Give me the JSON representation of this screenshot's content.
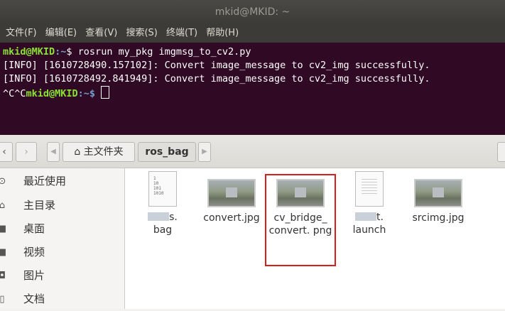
{
  "terminal": {
    "title": "mkid@MKID: ~",
    "menu": [
      "文件(F)",
      "编辑(E)",
      "查看(V)",
      "搜索(S)",
      "终端(T)",
      "帮助(H)"
    ],
    "prompt_user": "mkid@MKID",
    "prompt_path": ":~",
    "command": "$ rosrun my_pkg imgmsg_to_cv2.py",
    "lines": [
      "[INFO] [1610728490.157102]: Convert image_message to cv2_img successfully.",
      "[INFO] [1610728492.841949]: Convert image_message to cv2_img successfully."
    ],
    "last_prefix": "^C^C",
    "last_prompt_path": ":~$"
  },
  "toolbar": {
    "back_icon": "‹",
    "forward_icon": "›",
    "home_label": "主文件夹",
    "current_label": "ros_bag"
  },
  "sidebar": {
    "items": [
      {
        "label": "最近使用",
        "icon": "clock-icon"
      },
      {
        "label": "主目录",
        "icon": "home-icon"
      },
      {
        "label": "桌面",
        "icon": "desktop-icon"
      },
      {
        "label": "视频",
        "icon": "video-icon"
      },
      {
        "label": "图片",
        "icon": "camera-icon"
      },
      {
        "label": "文档",
        "icon": "document-icon"
      }
    ]
  },
  "files": [
    {
      "name_tail": "s.",
      "name_line2": "bag",
      "type": "binary"
    },
    {
      "name": "convert.jpg",
      "type": "image"
    },
    {
      "name": "cv_bridge_ convert. png",
      "type": "image",
      "highlighted": true
    },
    {
      "name_tail": "t.",
      "name_line2": "launch",
      "type": "text"
    },
    {
      "name": "srcimg.jpg",
      "type": "image"
    }
  ],
  "binary_icon_text": [
    "1",
    "10",
    "101",
    "1010"
  ]
}
